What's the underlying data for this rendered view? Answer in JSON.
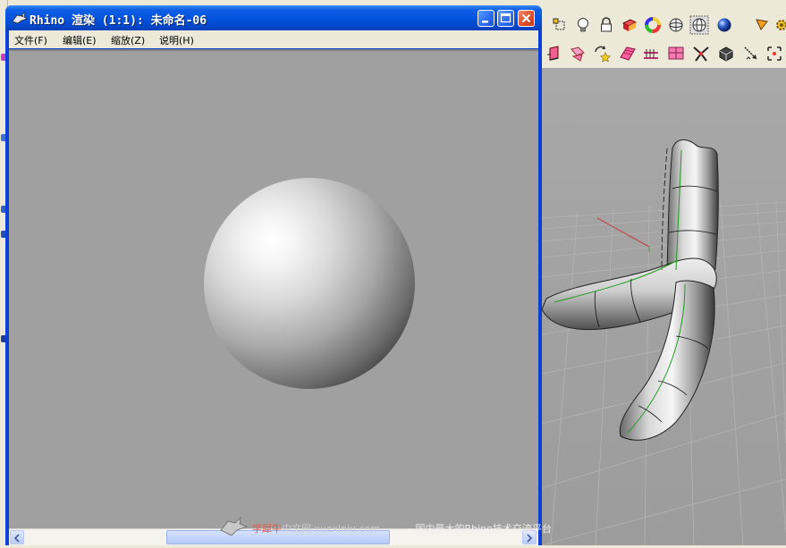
{
  "window": {
    "title": "Rhino 渲染 (1:1): 未命名-06"
  },
  "menu": {
    "items": [
      {
        "label": "文件(F)"
      },
      {
        "label": "编辑(E)"
      },
      {
        "label": "缩放(Z)"
      },
      {
        "label": "说明(H)"
      }
    ]
  },
  "watermark": {
    "site_cn_a": "学犀牛",
    "site_cn_b": "中文网 xuexiniu.com",
    "slogan": "- 国内最大的Rhino技术交流平台"
  },
  "toolbar_icons": [
    "snap-point-icon",
    "light-bulb-icon",
    "lock-icon",
    "render-mesh-icon",
    "color-wheel-icon",
    "sphere-wire-icon",
    "sphere-grid-icon",
    "render-sphere-icon",
    "tool-arrow-icon",
    "gear-icon",
    "extrude-curve-icon",
    "blend-surface-icon",
    "rotate-star-icon",
    "surface-patch-icon",
    "offset-surface-icon",
    "loft-icon",
    "split-icon",
    "solid-box-icon",
    "arrow-diagonal-icon"
  ],
  "colors": {
    "titlebar": "#0453dc",
    "render_background": "#a0a0a0",
    "viewport_background": "#a6a6a6"
  }
}
